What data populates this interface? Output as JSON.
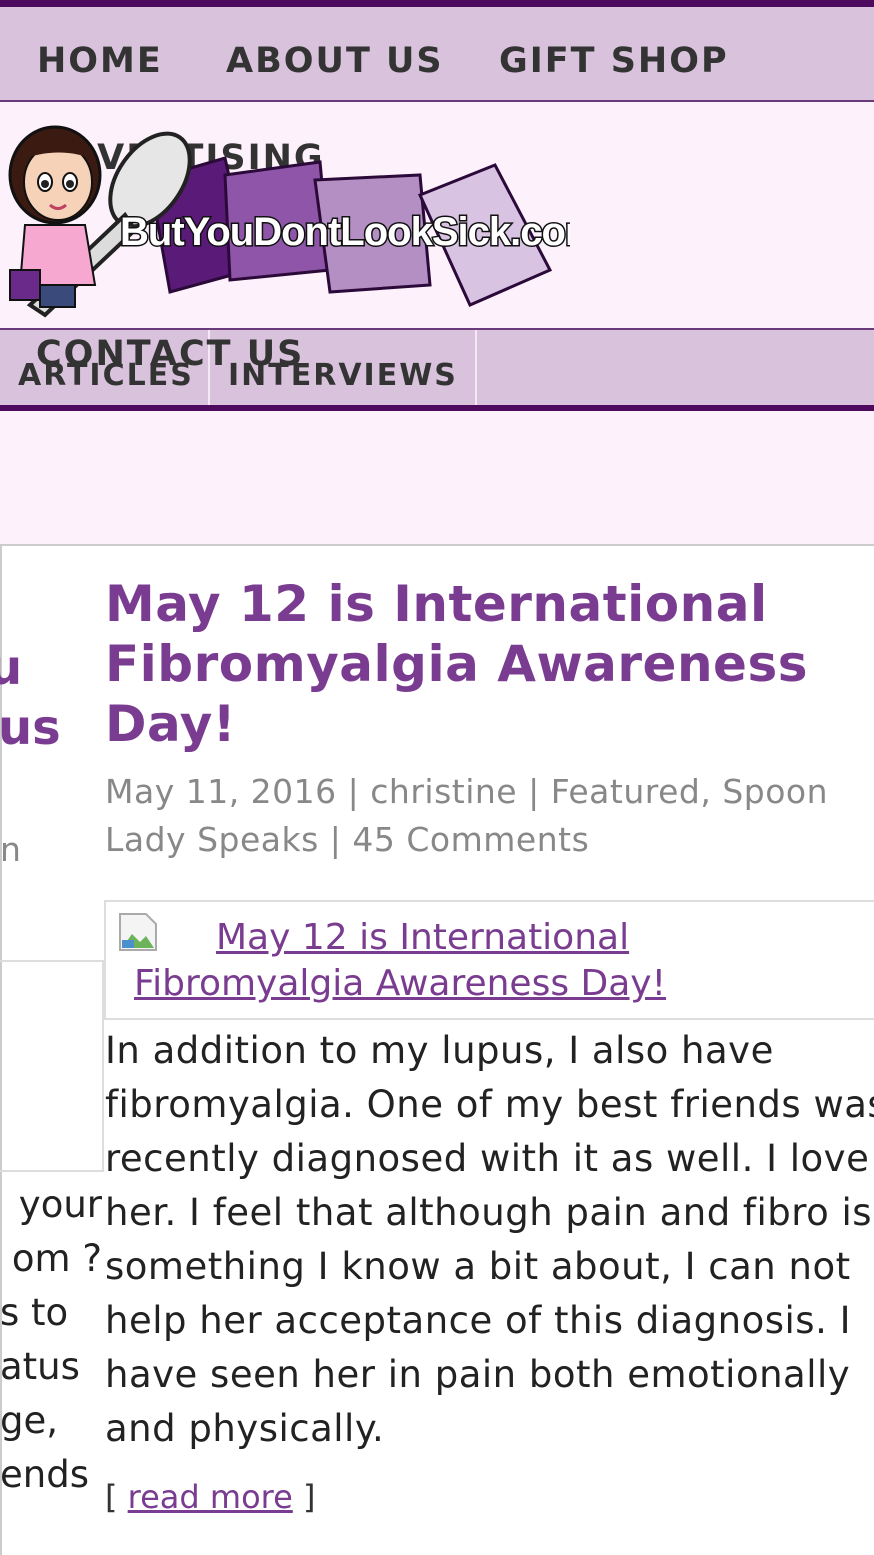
{
  "nav": {
    "home": "HOME",
    "about": "ABOUT US",
    "gift_shop": "GIFT SHOP",
    "advertising": "ADVERTISING",
    "contact": "CONTACT US"
  },
  "logo": {
    "text": "ButYouDontLookSick.com"
  },
  "subnav": {
    "articles": "ARTICLES",
    "interviews": "INTERVIEWS"
  },
  "sidebar": {
    "fragment1": "u",
    "fragment2": "us",
    "fragment3": "n",
    "lines": [
      "your",
      "om ?",
      "s to",
      "atus",
      "ge,",
      "ends"
    ]
  },
  "post": {
    "title": "May 12 is International Fibromyalgia Awareness Day!",
    "date": "May 11, 2016",
    "author": "christine",
    "categories": "Featured, Spoon Lady Speaks",
    "comments": "45 Comments",
    "image_alt": "May 12 is International Fibromyalgia Awareness Day!",
    "excerpt": "In addition to my lupus, I also have\nfibromyalgia. One of my best friends was\nrecently diagnosed with it as well. I love\nher. I feel that although pain and fibro is\nsomething I know a bit about, I can not\nhelp her acceptance of this diagnosis. I\nhave seen her in pain both emotionally\nand physically.",
    "read_more": "read more"
  },
  "colors": {
    "nav_bg": "#d9c2dc",
    "nav_border": "#4d0a5f",
    "accent": "#7a3c90",
    "page_bg": "#fdf2fb"
  }
}
